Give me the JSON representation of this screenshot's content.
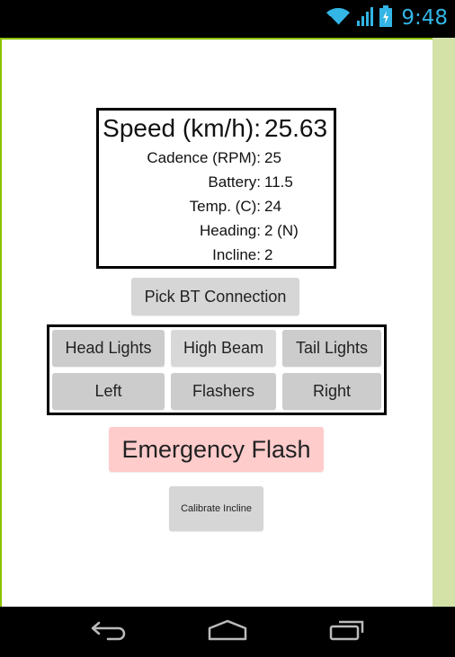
{
  "status_bar": {
    "time": "9:48",
    "icons": [
      "wifi-icon",
      "cell-signal-icon",
      "battery-charging-icon"
    ],
    "accent_color": "#33b5e5"
  },
  "readings": {
    "speed": {
      "label": "Speed (km/h):",
      "value": "25.63"
    },
    "rows": [
      {
        "label": "Cadence (RPM):",
        "value": "25"
      },
      {
        "label": "Battery:",
        "value": "11.5"
      },
      {
        "label": "Temp. (C):",
        "value": "24"
      },
      {
        "label": "Heading:",
        "value": "2 (N)"
      },
      {
        "label": "Incline:",
        "value": "2"
      }
    ]
  },
  "buttons": {
    "pick_bt": "Pick BT Connection",
    "controls": [
      {
        "label": "Head Lights"
      },
      {
        "label": "High Beam"
      },
      {
        "label": "Tail Lights"
      },
      {
        "label": "Left"
      },
      {
        "label": "Flashers"
      },
      {
        "label": "Right"
      }
    ],
    "emergency": "Emergency Flash",
    "calibrate": "Calibrate Incline"
  },
  "colors": {
    "emergency_bg": "#ffcccc",
    "button_bg": "#d6d6d6",
    "side_strip": "#d4e2a8"
  },
  "nav_bar": {
    "icons": [
      "back-icon",
      "home-icon",
      "recent-apps-icon"
    ]
  }
}
